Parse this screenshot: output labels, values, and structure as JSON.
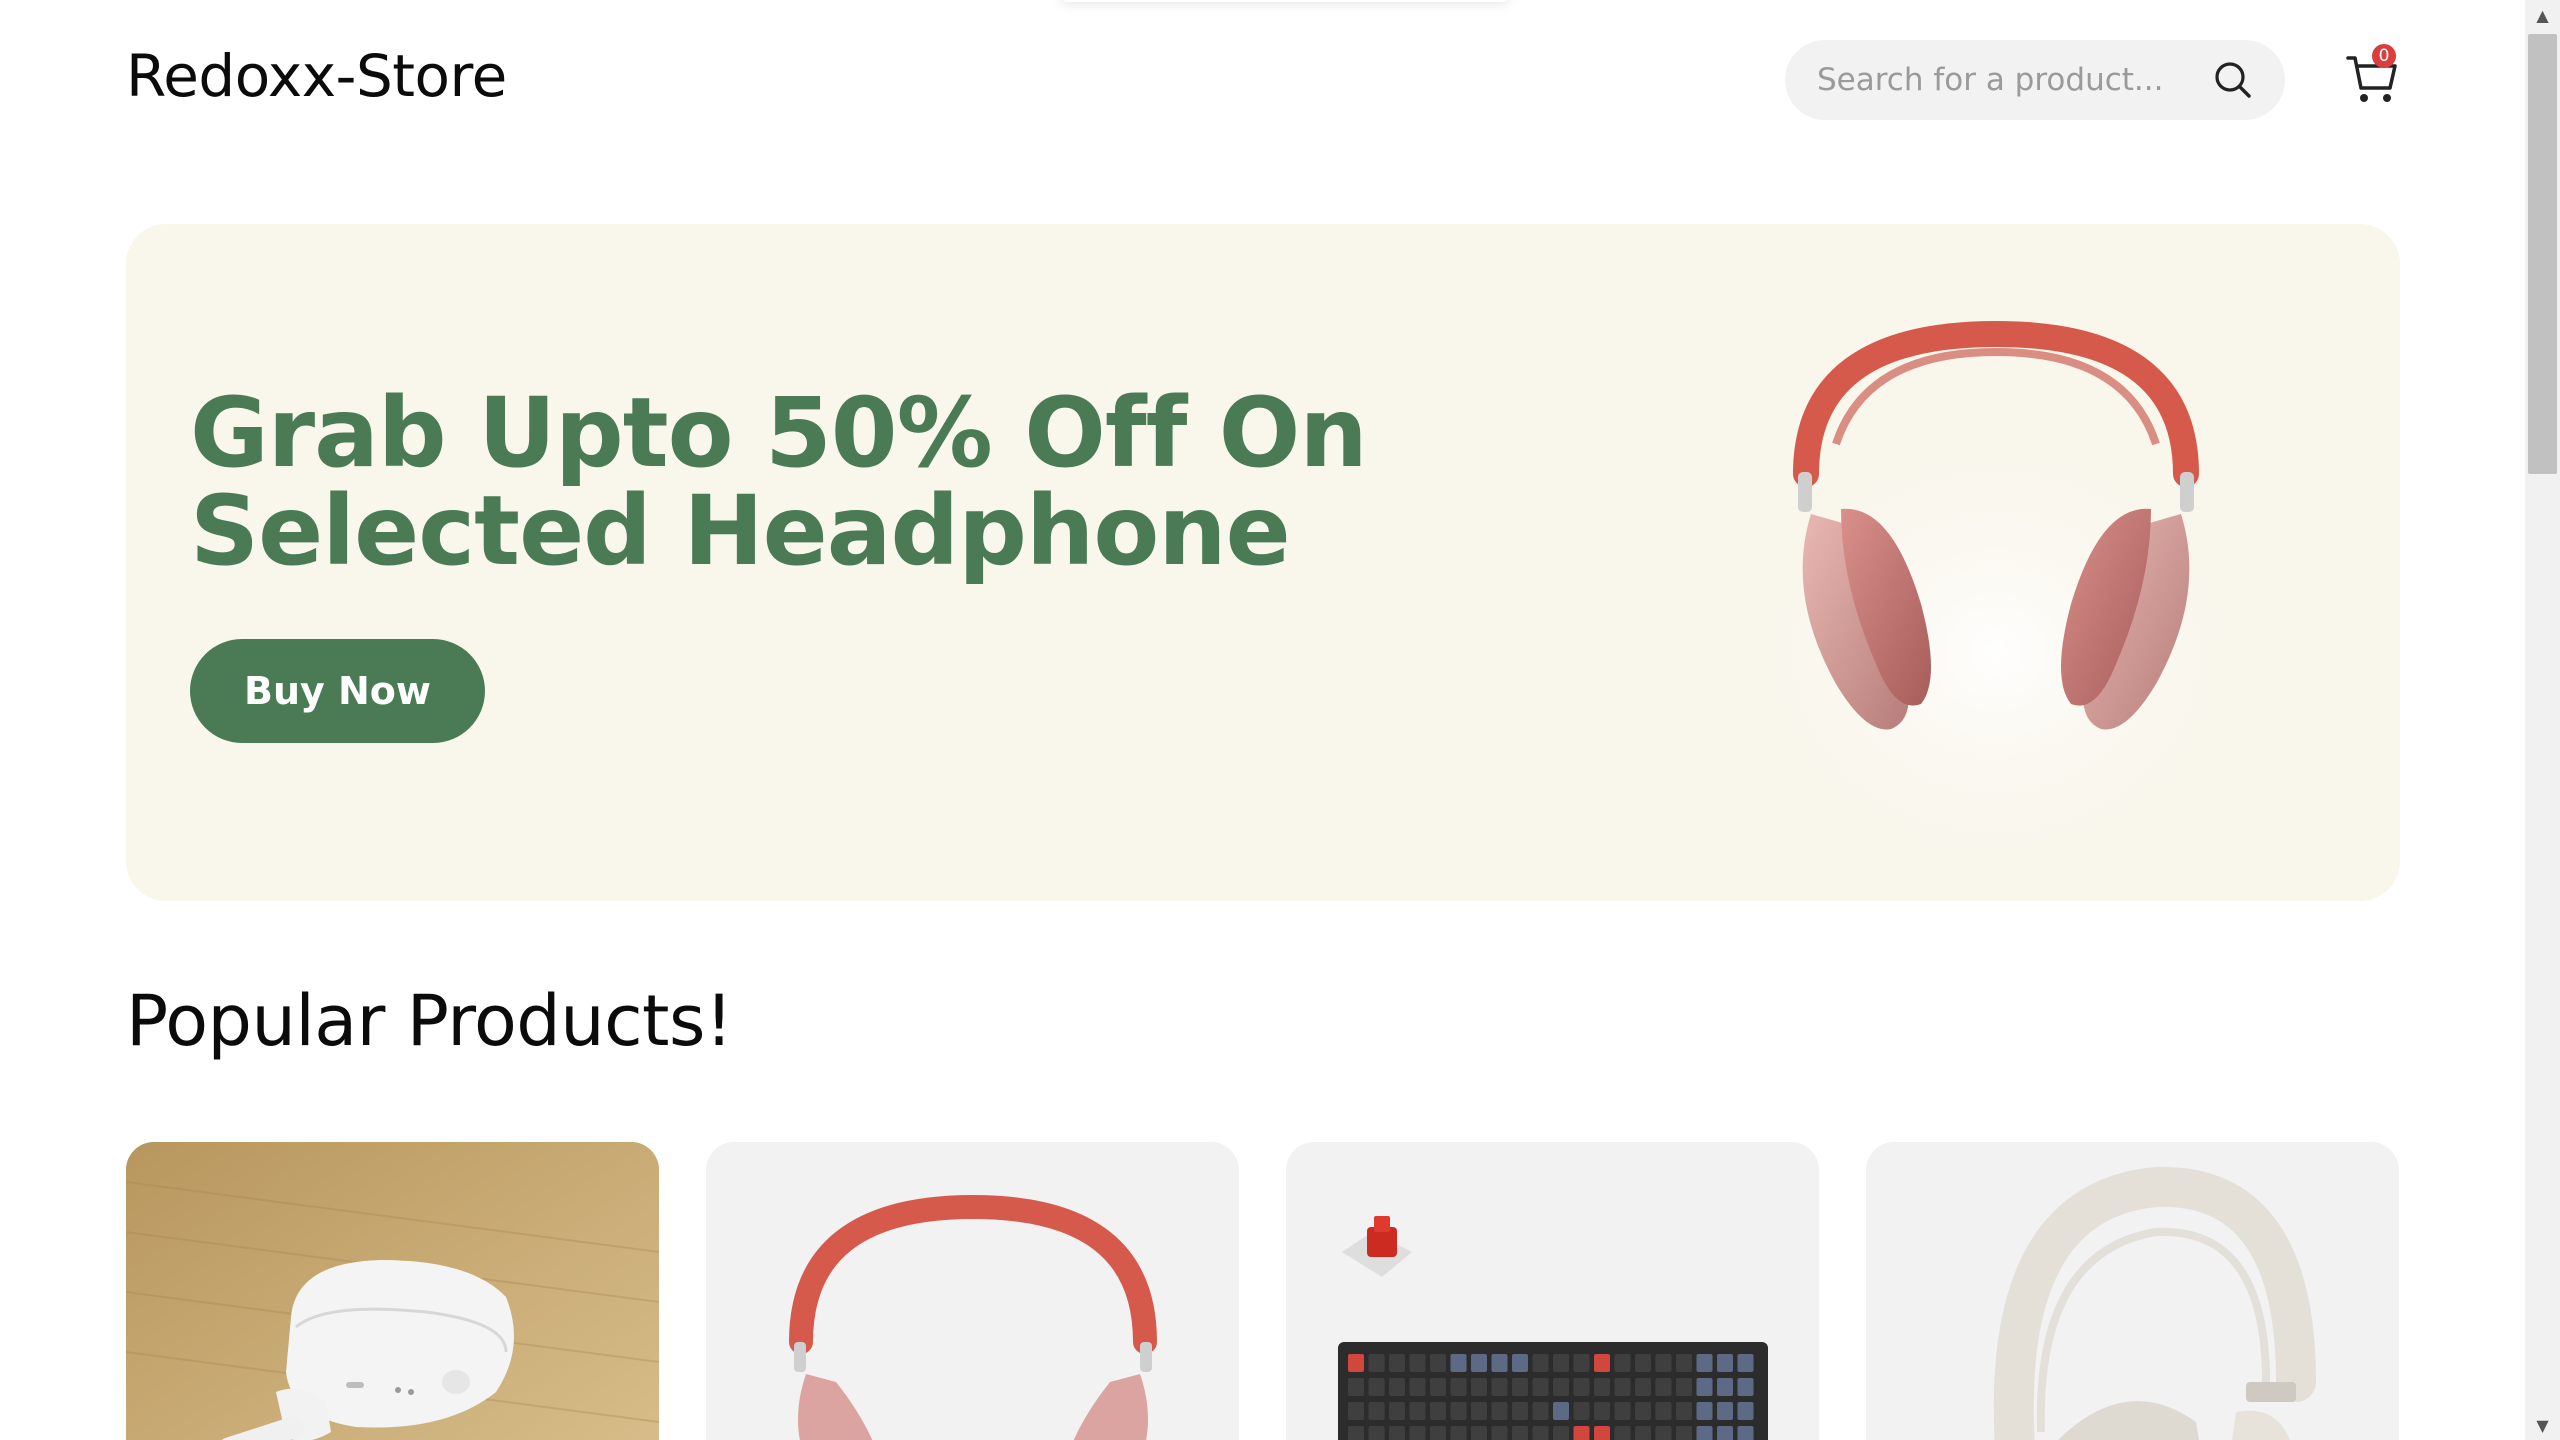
{
  "header": {
    "logo": "Redoxx-Store",
    "search_placeholder": "Search for a product...",
    "search_icon": "search-icon",
    "cart_icon": "cart-icon",
    "cart_count": "0"
  },
  "hero": {
    "title": "Grab Upto 50% Off On Selected Headphone",
    "button_label": "Buy Now",
    "image": "headphone-image"
  },
  "popular": {
    "title": "Popular Products!",
    "products": [
      {
        "image": "airpods-image"
      },
      {
        "image": "headphone-image"
      },
      {
        "image": "keyboard-image"
      },
      {
        "image": "white-headphone-image"
      }
    ]
  },
  "colors": {
    "accent": "#4a7b55",
    "hero_bg": "#f9f6ec",
    "card_bg": "#f2f2f2",
    "badge": "#d93d3d"
  }
}
